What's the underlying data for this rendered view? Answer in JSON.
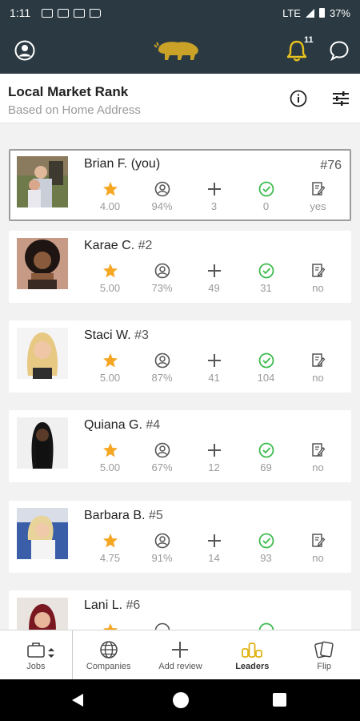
{
  "status_bar": {
    "time": "1:11",
    "network": "LTE",
    "battery": "37%"
  },
  "app_bar": {
    "notification_count": "11"
  },
  "header": {
    "title": "Local Market Rank",
    "subtitle": "Based on Home Address"
  },
  "colors": {
    "star": "#f5a623",
    "check": "#3dbb4e",
    "brand_gold": "#c9a227",
    "bar_bg": "#2b3a42"
  },
  "leaders": [
    {
      "name": "Brian F. (you)",
      "rank": "#76",
      "rating": "4.00",
      "percent": "94%",
      "plus": "3",
      "checks": "0",
      "flag": "yes"
    },
    {
      "name": "Karae C.",
      "rank": "#2",
      "rating": "5.00",
      "percent": "73%",
      "plus": "49",
      "checks": "31",
      "flag": "no"
    },
    {
      "name": "Staci W.",
      "rank": "#3",
      "rating": "5.00",
      "percent": "87%",
      "plus": "41",
      "checks": "104",
      "flag": "no"
    },
    {
      "name": "Quiana G.",
      "rank": "#4",
      "rating": "5.00",
      "percent": "67%",
      "plus": "12",
      "checks": "69",
      "flag": "no"
    },
    {
      "name": "Barbara B.",
      "rank": "#5",
      "rating": "4.75",
      "percent": "91%",
      "plus": "14",
      "checks": "93",
      "flag": "no"
    },
    {
      "name": "Lani L.",
      "rank": "#6"
    }
  ],
  "nav": {
    "jobs": "Jobs",
    "companies": "Companies",
    "add_review": "Add review",
    "leaders": "Leaders",
    "flip": "Flip"
  }
}
